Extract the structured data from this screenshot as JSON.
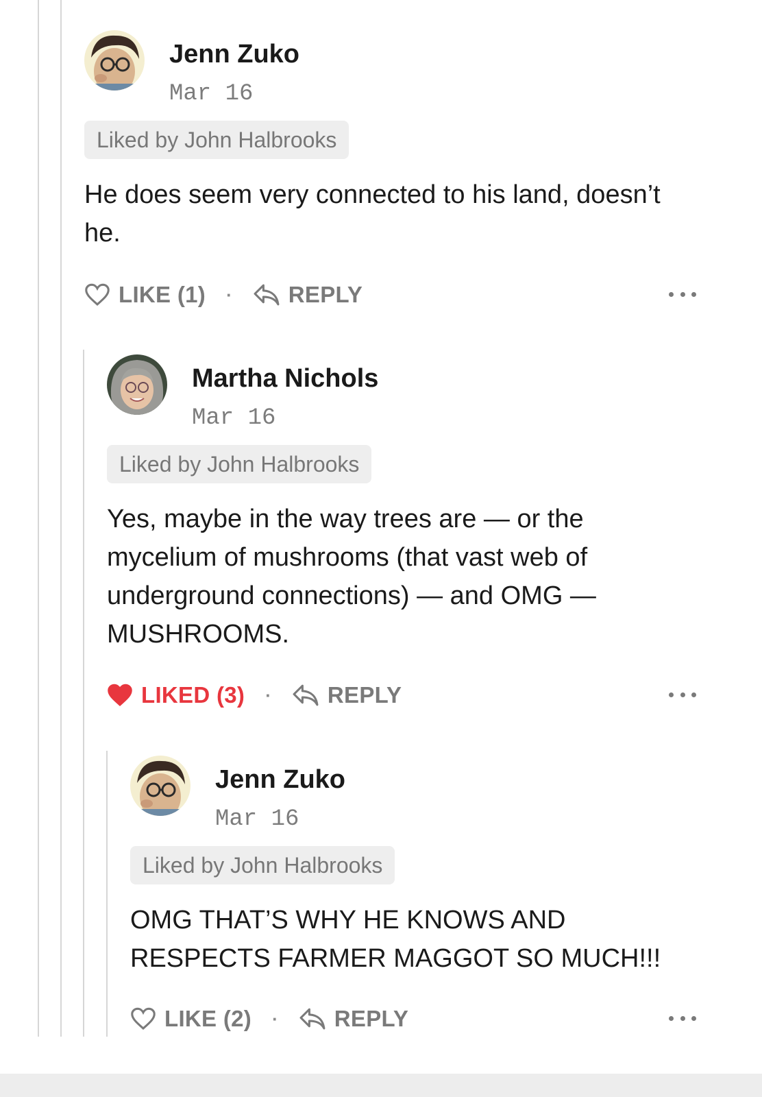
{
  "colors": {
    "liked": "#e8363e",
    "muted": "#7a7a7a",
    "badge_bg": "#eeeeee",
    "thread_line": "#d6d6d6"
  },
  "comments": [
    {
      "author": "Jenn Zuko",
      "date": "Mar 16",
      "liked_by": "Liked by John Halbrooks",
      "body_lines": [
        "He does seem very connected to his land, doesn’t",
        "he."
      ],
      "like_label": "LIKE (1)",
      "liked": false,
      "reply_label": "REPLY",
      "avatar_icon": "avatar-photo-jenn",
      "more_icon": "more-options-icon"
    },
    {
      "author": "Martha Nichols",
      "date": "Mar 16",
      "liked_by": "Liked by John Halbrooks",
      "body_lines": [
        "Yes, maybe in the way trees are — or the",
        "mycelium of mushrooms (that vast web of",
        "underground connections) — and OMG —",
        "MUSHROOMS."
      ],
      "like_label": "LIKED (3)",
      "liked": true,
      "reply_label": "REPLY",
      "avatar_icon": "avatar-photo-martha",
      "more_icon": "more-options-icon"
    },
    {
      "author": "Jenn Zuko",
      "date": "Mar 16",
      "liked_by": "Liked by John Halbrooks",
      "body_lines": [
        "OMG THAT’S WHY HE KNOWS AND",
        "RESPECTS FARMER MAGGOT SO MUCH!!!"
      ],
      "like_label": "LIKE (2)",
      "liked": false,
      "reply_label": "REPLY",
      "avatar_icon": "avatar-photo-jenn",
      "more_icon": "more-options-icon"
    }
  ]
}
